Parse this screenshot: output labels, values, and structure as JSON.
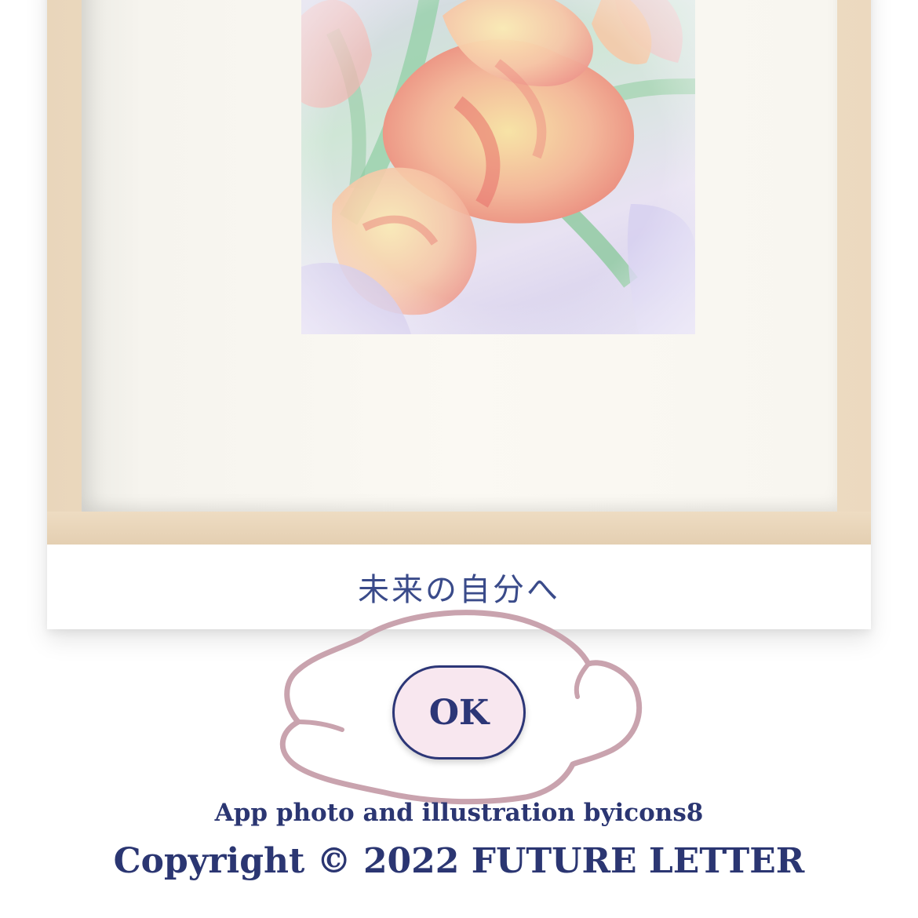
{
  "card": {
    "photo_icon": "tulip-photo-image",
    "caption": "未来の自分へ"
  },
  "actions": {
    "ok_label": "OK"
  },
  "footer": {
    "credit": "App photo and illustration byicons8",
    "copyright": "Copyright © 2022 FUTURE LETTER"
  },
  "colors": {
    "text_primary": "#2c3677",
    "button_fill": "#f8e7ef",
    "scribble": "#c9a3ae",
    "frame_wood": "#ecd9bf"
  }
}
